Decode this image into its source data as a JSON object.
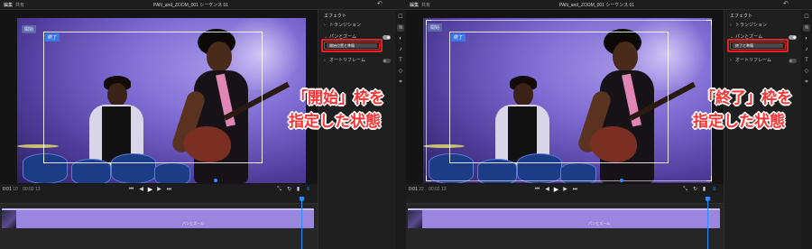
{
  "panels": [
    {
      "id": "left",
      "tabs": {
        "edit": "編集",
        "share": "共有"
      },
      "document_title": "PAN_and_ZOOM_001 シーケンス 01",
      "frame_tags": {
        "start": "開始",
        "end": "終了"
      },
      "sidebar": {
        "title": "エフェクト",
        "rows": [
          "トランジション",
          "パンとズーム",
          "オートリフレーム"
        ],
        "action_button": "開始位置と準備"
      },
      "timecode": {
        "current": "0:01",
        "current_frames": "10",
        "duration": "00:02",
        "duration_frames": "13"
      },
      "clip_label": "パンとズーム",
      "annotation": {
        "line1": "「開始」枠を",
        "line2": "指定した状態"
      }
    },
    {
      "id": "right",
      "tabs": {
        "edit": "編集",
        "share": "共有"
      },
      "document_title": "PAN_and_ZOOM_001 シーケンス 01",
      "frame_tags": {
        "start": "開始",
        "end": "終了"
      },
      "sidebar": {
        "title": "エフェクト",
        "rows": [
          "トランジション",
          "パンとズーム",
          "オートリフレーム"
        ],
        "action_button": "終了と準備"
      },
      "timecode": {
        "current": "0:01",
        "current_frames": "22",
        "duration": "00:02",
        "duration_frames": "13"
      },
      "clip_label": "パンとズーム",
      "annotation": {
        "line1": "「終了」枠を",
        "line2": "指定した状態"
      }
    }
  ],
  "icons": {
    "undo": "undo-icon",
    "transport": [
      "skip-to-start-icon",
      "step-back-icon",
      "play-icon",
      "step-forward-icon",
      "skip-to-end-icon"
    ],
    "right_tools": [
      "fit-icon",
      "loop-icon",
      "volume-icon",
      "menu-icon"
    ],
    "iconbar": [
      "comment-icon",
      "effects-icon",
      "color-icon",
      "audio-icon",
      "text-icon",
      "shape-icon",
      "crop-icon"
    ]
  },
  "colors": {
    "accent": "#2a8cff",
    "highlight": "#e02424",
    "clip": "#9a86df",
    "annotation": "#ff3232"
  }
}
